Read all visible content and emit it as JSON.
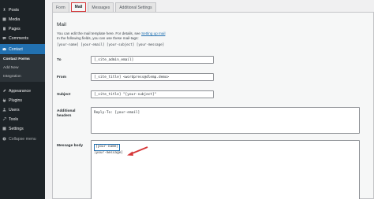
{
  "sidebar": {
    "items": [
      {
        "label": "Posts",
        "icon": "pin-icon"
      },
      {
        "label": "Media",
        "icon": "media-icon"
      },
      {
        "label": "Pages",
        "icon": "page-icon"
      },
      {
        "label": "Comments",
        "icon": "comment-icon"
      },
      {
        "label": "Contact",
        "icon": "mail-icon"
      },
      {
        "label": "Appearance",
        "icon": "brush-icon"
      },
      {
        "label": "Plugins",
        "icon": "plug-icon"
      },
      {
        "label": "Users",
        "icon": "user-icon"
      },
      {
        "label": "Tools",
        "icon": "wrench-icon"
      },
      {
        "label": "Settings",
        "icon": "settings-icon"
      },
      {
        "label": "Collapse menu",
        "icon": "collapse-icon"
      }
    ],
    "sub": [
      "Contact Forms",
      "Add New",
      "Integration"
    ]
  },
  "tabs": [
    "Form",
    "Mail",
    "Messages",
    "Additional Settings"
  ],
  "mail": {
    "heading": "Mail",
    "intro_text": "You can edit the mail template here. For details, see ",
    "intro_link": "Setting up mail",
    "intro_text2": "In the following fields, you can use these mail-tags:",
    "tags": "[your-name] [your-email] [your-subject] [your-message]",
    "to_label": "To",
    "to_value": "[_site_admin_email]",
    "from_label": "From",
    "from_value": "[_site_title] <wordpress@dlemp.demo>",
    "subject_label": "Subject",
    "subject_value": "[_site_title] \"[your-subject]\"",
    "headers_label": "Additional headers",
    "headers_value": "Reply-To: [your-email]",
    "body_label": "Message body",
    "body_line1": "[your-name]",
    "body_line2": "[your-message]"
  },
  "colors": {
    "accent": "#2271b1",
    "sidebar": "#1d2327",
    "highlight": "#d63638"
  }
}
